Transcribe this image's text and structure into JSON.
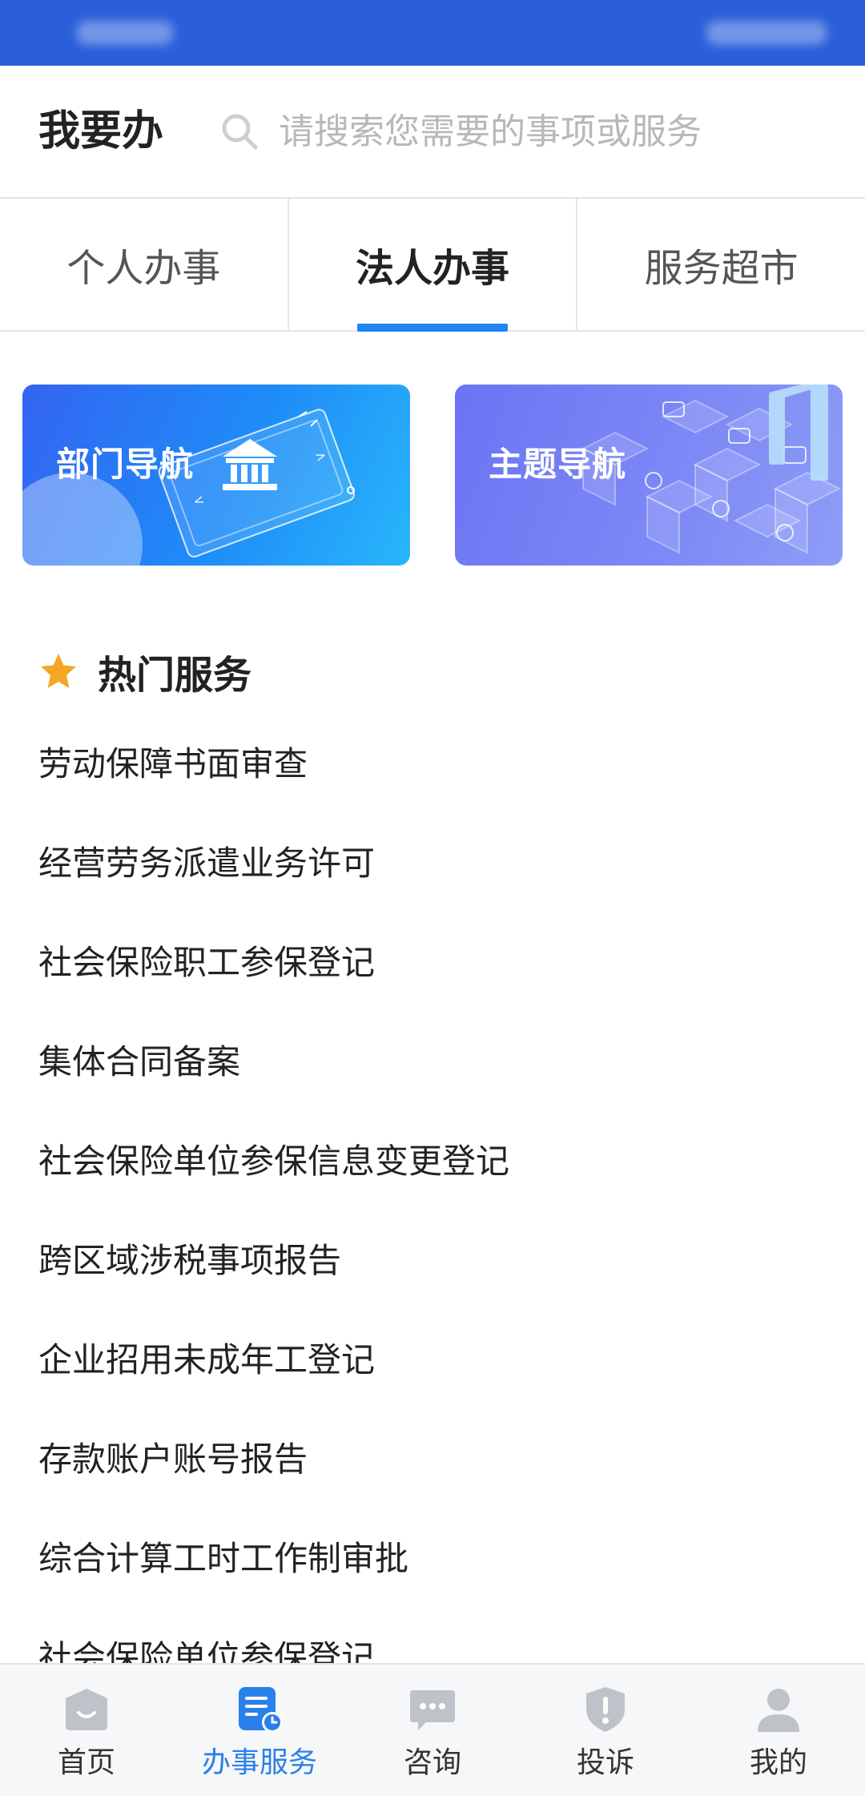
{
  "header": {
    "title": "我要办",
    "search_placeholder": "请搜索您需要的事项或服务"
  },
  "tabs": [
    {
      "label": "个人办事",
      "active": false
    },
    {
      "label": "法人办事",
      "active": true
    },
    {
      "label": "服务超市",
      "active": false
    }
  ],
  "banners": [
    {
      "label": "部门导航",
      "icon": "government-building-icon"
    },
    {
      "label": "主题导航",
      "icon": "theme-cubes-icon"
    }
  ],
  "hot_services": {
    "title": "热门服务",
    "icon": "star-icon",
    "items": [
      "劳动保障书面审查",
      "经营劳务派遣业务许可",
      "社会保险职工参保登记",
      "集体合同备案",
      "社会保险单位参保信息变更登记",
      "跨区域涉税事项报告",
      "企业招用未成年工登记",
      "存款账户账号报告",
      "综合计算工时工作制审批",
      "社会保险单位参保登记"
    ]
  },
  "bottom_nav": [
    {
      "label": "首页",
      "icon": "home-icon",
      "active": false
    },
    {
      "label": "办事服务",
      "icon": "service-document-icon",
      "active": true
    },
    {
      "label": "咨询",
      "icon": "chat-icon",
      "active": false
    },
    {
      "label": "投诉",
      "icon": "shield-alert-icon",
      "active": false
    },
    {
      "label": "我的",
      "icon": "user-icon",
      "active": false
    }
  ],
  "colors": {
    "status_bar": "#2a5fd9",
    "accent": "#1d86f0",
    "star": "#f5a623",
    "nav_active": "#2a80ea"
  }
}
